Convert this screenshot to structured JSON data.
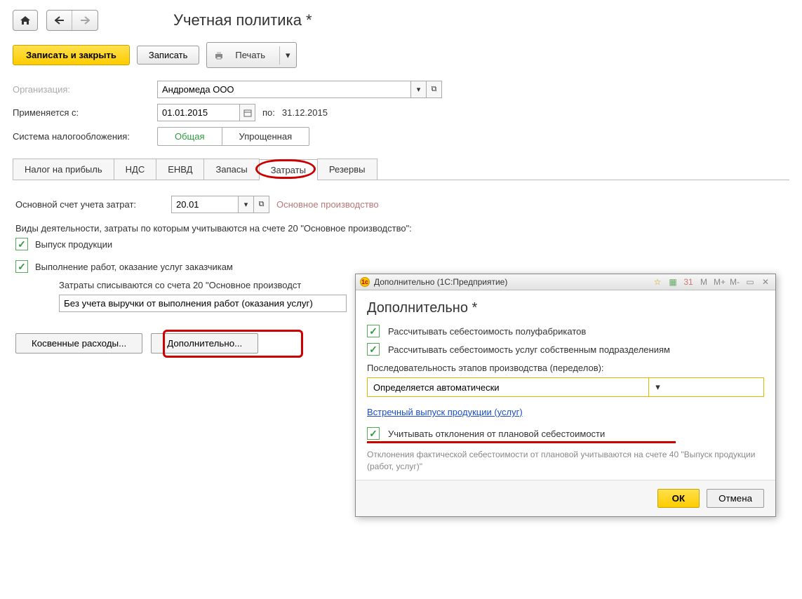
{
  "header": {
    "title": "Учетная политика *"
  },
  "toolbar": {
    "save_close": "Записать и закрыть",
    "save": "Записать",
    "print": "Печать"
  },
  "form": {
    "org_label": "Организация:",
    "org_value": "Андромеда ООО",
    "applies_label": "Применяется с:",
    "date_from": "01.01.2015",
    "date_sep": "по:",
    "date_to": "31.12.2015",
    "tax_label": "Система налогообложения:",
    "tax_common": "Общая",
    "tax_simple": "Упрощенная"
  },
  "tabs": [
    "Налог на прибыль",
    "НДС",
    "ЕНВД",
    "Запасы",
    "Затраты",
    "Резервы"
  ],
  "costs": {
    "account_label": "Основной счет учета затрат:",
    "account_value": "20.01",
    "account_name": "Основное производство",
    "activities_label": "Виды деятельности, затраты по которым учитываются на счете 20 \"Основное производство\":",
    "cb_output": "Выпуск продукции",
    "cb_services": "Выполнение работ, оказание услуг заказчикам",
    "writeoff_label": "Затраты списываются со счета 20 \"Основное производст",
    "writeoff_value": "Без учета выручки от выполнения работ (оказания услуг)",
    "btn_indirect": "Косвенные расходы...",
    "btn_additional": "Дополнительно..."
  },
  "modal": {
    "window_title": "Дополнительно  (1С:Предприятие)",
    "heading": "Дополнительно *",
    "cb_semi": "Рассчитывать себестоимость полуфабрикатов",
    "cb_internal": "Рассчитывать себестоимость услуг собственным подразделениям",
    "seq_label": "Последовательность этапов производства (переделов):",
    "seq_value": "Определяется автоматически",
    "link_counter": "Встречный выпуск продукции (услуг)",
    "cb_deviation": "Учитывать отклонения от плановой себестоимости",
    "hint": "Отклонения фактической себестоимости от плановой учитываются на счете 40 \"Выпуск продукции (работ, услуг)\"",
    "ok": "ОК",
    "cancel": "Отмена",
    "mem_buttons": [
      "M",
      "M+",
      "M-"
    ]
  }
}
